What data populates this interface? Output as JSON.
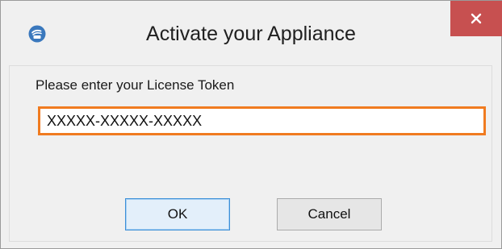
{
  "window": {
    "title": "Activate your Appliance",
    "icon": "appliance-logo-icon",
    "close_icon": "close-icon"
  },
  "form": {
    "prompt": "Please enter your License Token",
    "token_value": "XXXXX-XXXXX-XXXXX"
  },
  "buttons": {
    "ok_label": "OK",
    "cancel_label": "Cancel"
  },
  "colors": {
    "close_button": "#c75050",
    "input_focus_border": "#f07b20",
    "default_button_border": "#3c8fd8"
  }
}
